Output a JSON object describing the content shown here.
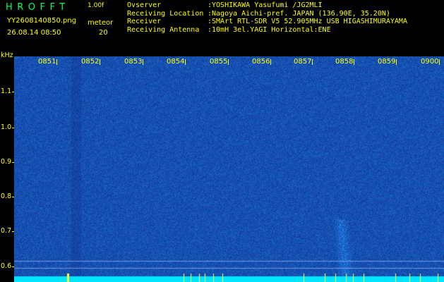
{
  "header": {
    "logo": "HROFFT",
    "version": "1.00f",
    "filename": "YY2608140850.png",
    "datetime": "26.08.14 08:50",
    "meteor_label": "meteor",
    "meteor_count": "20",
    "info_labels": [
      "Ovserver",
      "Receiving Location",
      "Receiver",
      "Receiving Antenna"
    ],
    "info_values": [
      ":YOSHIKAWA Yasufumi /JG2MLI",
      ":Nagoya Aichi-pref. JAPAN (136.90E, 35.20N)",
      ":SMArt RTL-SDR V5 52.905MHz USB HIGASHIMURAYAMA",
      ":10mH 3el.YAGI Horizontal:ENE"
    ]
  },
  "axis": {
    "y_unit": "kHz",
    "y_ticks": [
      "1.1",
      "1.0",
      "0.9",
      "0.8",
      "0.7",
      "0.6"
    ],
    "x_ticks": [
      "0851",
      "0852",
      "0853",
      "0854",
      "0855",
      "0856",
      "0857",
      "0858",
      "0859",
      "0900"
    ]
  },
  "colors": {
    "background": "#000000",
    "text": "#ffff00",
    "spectrogram_base": "#0a2a9e",
    "baseline": "#00e5ff"
  }
}
